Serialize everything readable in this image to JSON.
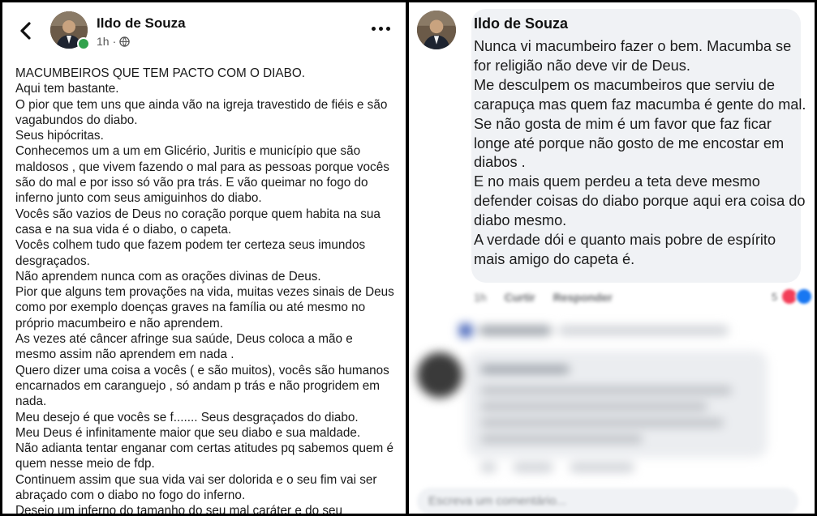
{
  "post": {
    "author": "Ildo de Souza",
    "time": "1h",
    "paragraphs": [
      "MACUMBEIROS QUE TEM PACTO COM O DIABO.",
      "Aqui tem bastante.",
      "O pior que tem uns que ainda vão na igreja travestido de fiéis e são vagabundos do diabo.",
      "Seus hipócritas.",
      "Conhecemos um a um em Glicério, Juritis e município que são maldosos , que vivem fazendo o mal para as pessoas porque vocês são do mal e por isso só vão pra trás. E vão queimar no fogo do inferno junto com seus amiguinhos do diabo.",
      "Vocês são vazios de Deus no coração porque quem habita na sua casa e na sua vida é o diabo, o capeta.",
      "Vocês colhem tudo que fazem podem ter certeza seus imundos desgraçados.",
      "Não aprendem nunca com as orações divinas de Deus.",
      "Pior que alguns tem provações na vida,  muitas vezes sinais de Deus como por exemplo doenças graves na família ou até mesmo no próprio macumbeiro e não aprendem.",
      "As vezes até câncer afringe sua saúde, Deus coloca a mão e mesmo assim não aprendem em nada .",
      "Quero dizer uma coisa a vocês ( e são muitos), vocês são humanos encarnados em caranguejo , só andam p trás e não progridem em nada.",
      "Meu desejo é que vocês se f....... Seus desgraçados do diabo.",
      "Meu Deus é infinitamente maior que seu diabo e sua maldade.",
      "Não adianta tentar enganar com  certas atitudes pq sabemos quem é quem nesse meio de fdp.",
      "Continuem assim que sua vida vai ser dolorida e o seu fim vai ser abraçado com o diabo no fogo do inferno.",
      "Desejo um inferno do tamanho do seu mal caráter e do seu"
    ]
  },
  "comment": {
    "author": "Ildo de Souza",
    "paragraphs": [
      "Nunca vi macumbeiro fazer o bem. Macumba se for religião não deve vir de Deus.",
      "Me desculpem os macumbeiros que serviu de carapuça mas quem faz macumba é gente do mal. Se não gosta de mim é um favor que faz ficar longe até porque não gosto de me encostar em diabos .",
      "E no mais quem perdeu a teta deve mesmo defender coisas do diabo porque aqui era coisa do diabo mesmo.",
      "A verdade dói e quanto mais pobre de espírito mais amigo do capeta é."
    ],
    "time": "1h",
    "like_label": "Curtir",
    "reply_label": "Responder",
    "reaction_count": "5"
  },
  "input": {
    "placeholder": "Escreva um comentário..."
  },
  "colors": {
    "online": "#31a24c",
    "like": "#1877f2",
    "love": "#f33e58",
    "bubble": "#f0f2f5"
  }
}
